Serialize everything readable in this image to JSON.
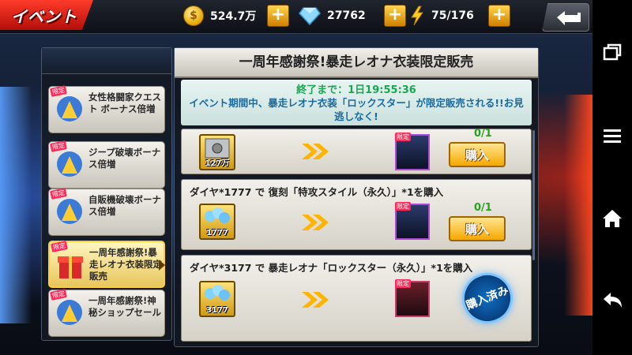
{
  "header": {
    "title": "イベント",
    "gold": "524.7万",
    "diamonds": "27762",
    "stamina": "75/176"
  },
  "sidebar": {
    "items": [
      {
        "label": "女性格闘家クエスト ボーナス倍増",
        "badge": "限定",
        "selected": false
      },
      {
        "label": "ジープ破壊ボーナス倍増",
        "badge": "限定",
        "selected": false
      },
      {
        "label": "自販機破壊ボーナス倍増",
        "badge": "限定",
        "selected": false
      },
      {
        "label": "一周年感謝祭!暴走レオナ衣装限定販売",
        "badge": "限定",
        "selected": true
      },
      {
        "label": "一周年感謝祭!神秘ショップセール",
        "badge": "限定",
        "selected": false
      }
    ]
  },
  "panel": {
    "title": "一周年感謝祭!暴走レオナ衣装限定販売",
    "timer_label": "終了まで：1日19:55:36",
    "description": "イベント期間中、暴走レオナ衣装「ロックスター」が限定販売される!!お見逃しなく!",
    "rows": [
      {
        "label": "",
        "cost_amount": "127万",
        "progress": "0/1",
        "button": "購入",
        "portrait_tag": "限定",
        "purchased": false
      },
      {
        "label": "ダイヤ*1777 で 復刻「特攻スタイル（永久）」*1を購入",
        "cost_amount": "1777",
        "progress": "0/1",
        "button": "購入",
        "portrait_tag": "限定",
        "purchased": false
      },
      {
        "label": "ダイヤ*3177 で 暴走レオナ「ロックスター（永久）」*1を購入",
        "cost_amount": "3177",
        "progress": "",
        "button": "購入済み",
        "portrait_tag": "限定",
        "purchased": true
      }
    ]
  },
  "icons": {
    "gold": "coin-icon",
    "diamond": "diamond-icon",
    "stamina": "lightning-icon",
    "back": "back-arrow-icon"
  },
  "colors": {
    "accent_red": "#d8190f",
    "gold": "#f6a800",
    "timer_green": "#18a850",
    "desc_blue": "#1a6aa0"
  }
}
